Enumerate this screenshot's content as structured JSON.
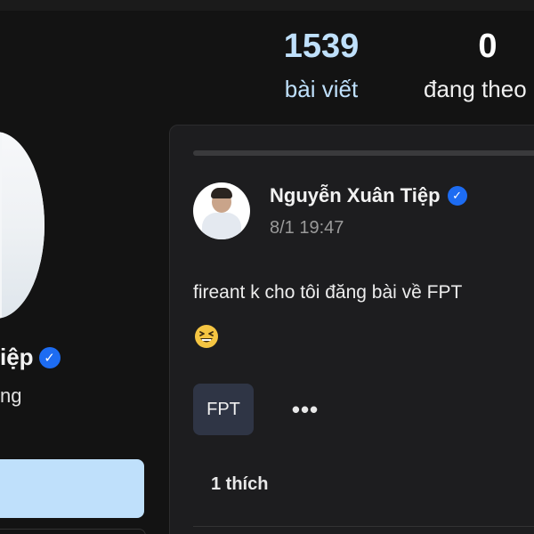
{
  "stats": {
    "posts": {
      "value": "1539",
      "label": "bài viết"
    },
    "following": {
      "value": "0",
      "label": "đang theo"
    }
  },
  "profile": {
    "name": "iệp",
    "subtext": "ng",
    "verified_icon": "verified-check-icon"
  },
  "post": {
    "author": "Nguyễn Xuân Tiệp",
    "time": "8/1 19:47",
    "text": "fireant k cho tôi đăng bài về FPT",
    "emoji": "grinning-squinting-face-emoji",
    "tag": "FPT",
    "more_label": "•••",
    "likes": "1 thích"
  },
  "colors": {
    "background": "#131313",
    "card": "#1d1d1f",
    "accent": "#bfe0fb",
    "verified": "#1d6cf2",
    "tag": "#2f3545"
  }
}
